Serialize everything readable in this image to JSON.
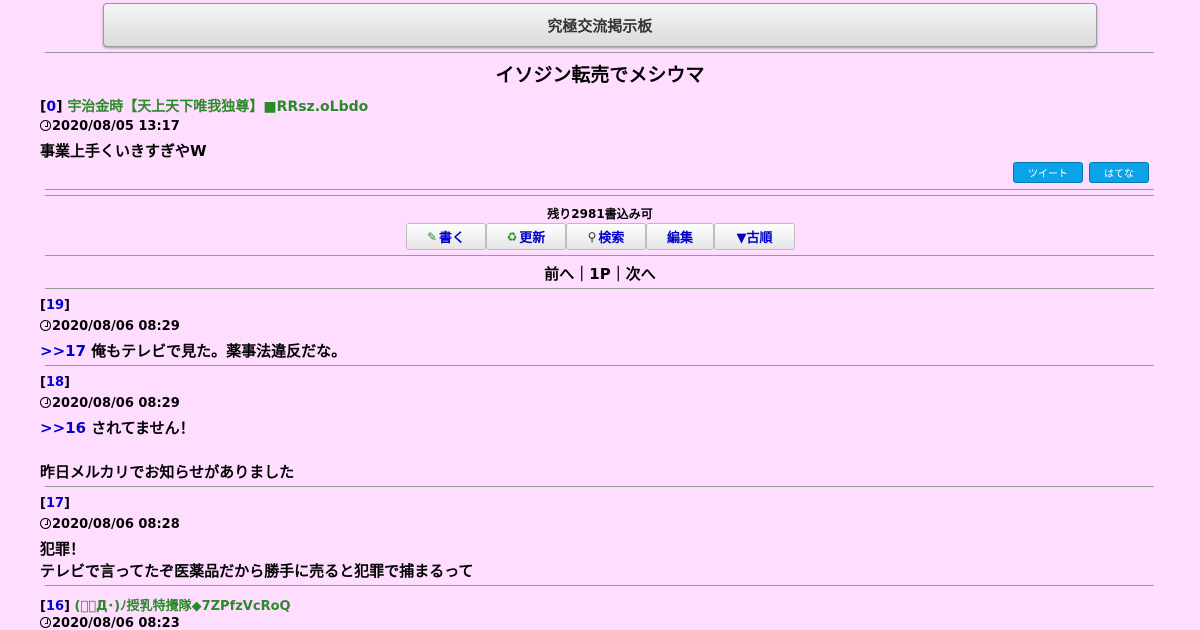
{
  "header": {
    "site_title": "究極交流掲示板"
  },
  "thread": {
    "title": "イソジン転売でメシウマ"
  },
  "first_post": {
    "number": "0",
    "name": "宇治金時【天上天下唯我独尊】■RRsz.oLbdo",
    "date": "2020/08/05 13:17",
    "body": "事業上手くいきすぎやW"
  },
  "share": {
    "tweet": "ツイート",
    "hatena": "はてな"
  },
  "controls": {
    "remaining": "残り2981書込み可",
    "write": "書く",
    "update": "更新",
    "search": "検索",
    "edit": "編集",
    "old_order": "▼古順"
  },
  "pager": {
    "prev": "前へ",
    "sep1": "｜",
    "page": "1P",
    "sep2": "｜",
    "next": "次へ"
  },
  "posts": [
    {
      "number": "19",
      "date": "2020/08/06 08:29",
      "anchor": ">>17",
      "lines": [
        "俺もテレビで見た。薬事法違反だな。"
      ]
    },
    {
      "number": "18",
      "date": "2020/08/06 08:29",
      "anchor": ">>16",
      "lines": [
        "されてません！",
        "",
        "昨日メルカリでお知らせがありました"
      ]
    },
    {
      "number": "17",
      "date": "2020/08/06 08:28",
      "anchor": "",
      "lines": [
        "犯罪！",
        "テレビで言ってたぞ医薬品だから勝手に売ると犯罪で捕まるって"
      ]
    },
    {
      "number": "16",
      "name": "(ﾟ･Д･)ﾉ授乳特攪隊◆7ZPfzVcRoQ",
      "date": "2020/08/06 08:23"
    }
  ],
  "colors": {
    "background": "#ffddff",
    "link": "#0000cc",
    "name": "#2a8a2a",
    "share": "#0aa3e8"
  }
}
